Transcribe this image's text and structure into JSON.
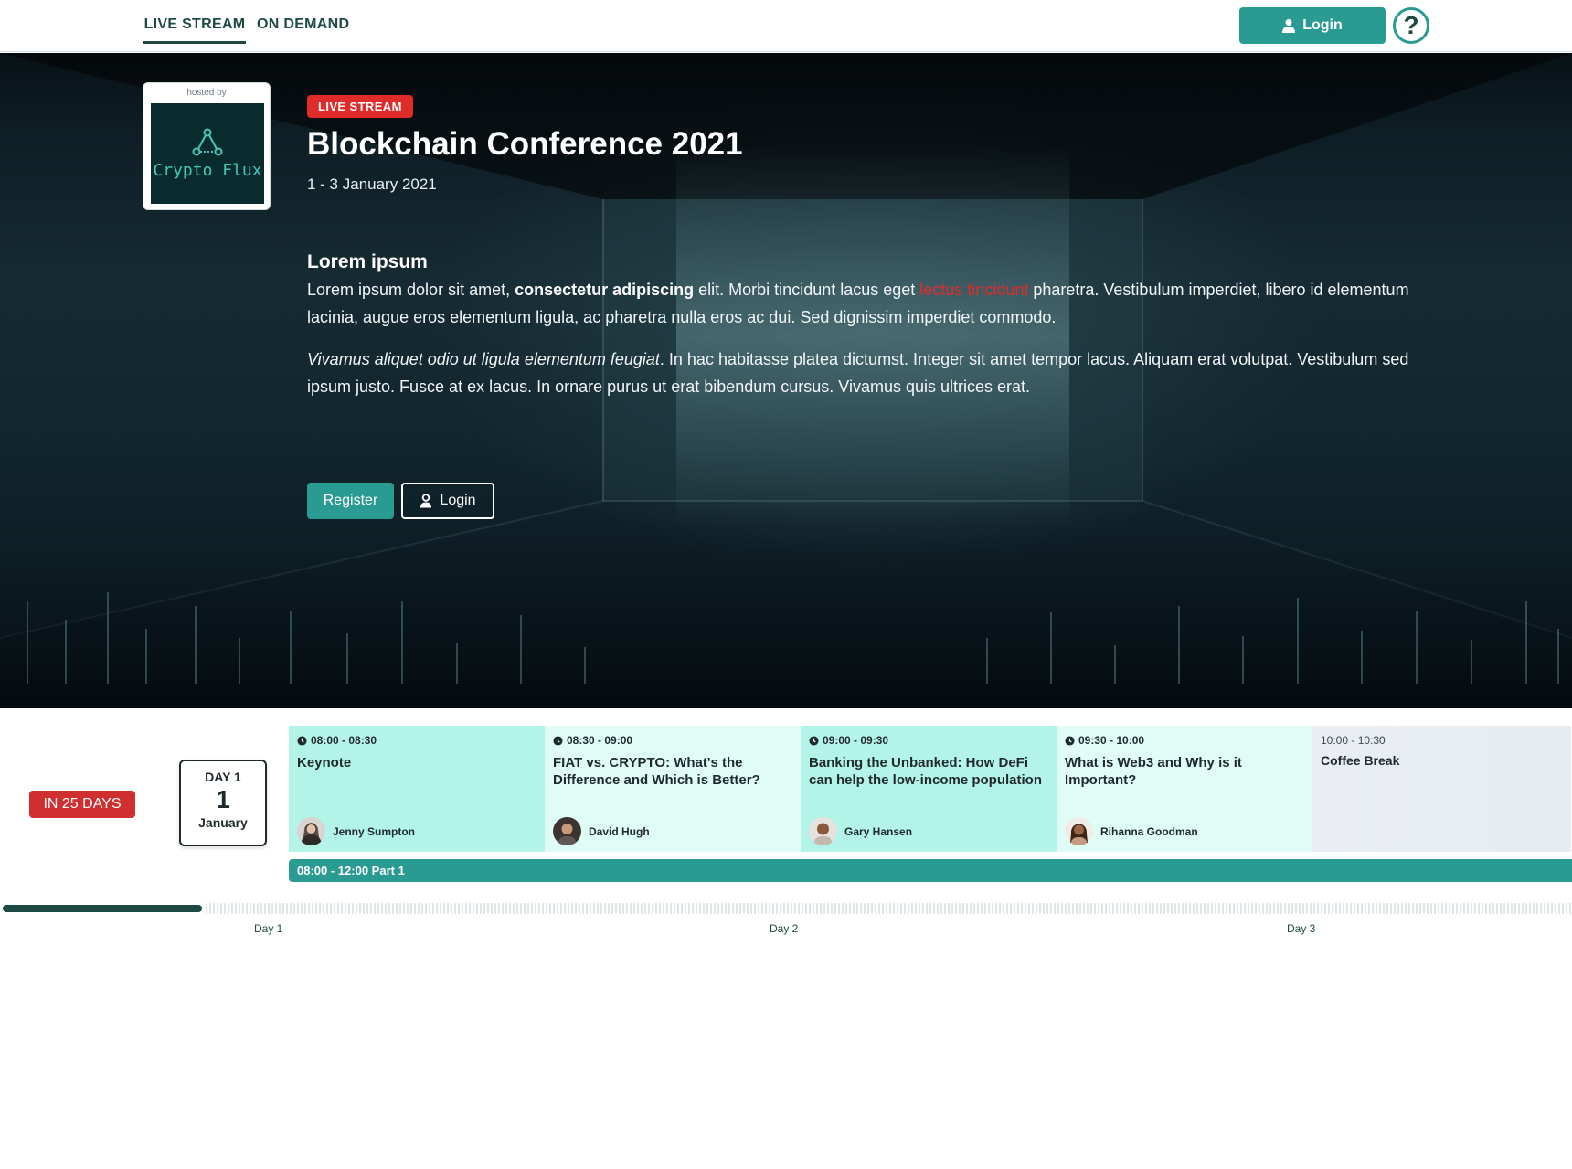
{
  "nav": {
    "tabs": [
      {
        "label": "LIVE STREAM",
        "active": true
      },
      {
        "label": "ON DEMAND",
        "active": false
      }
    ],
    "login_label": "Login",
    "help_symbol": "?",
    "accent": "#2a9b93"
  },
  "hero": {
    "host_label": "hosted by",
    "host_name": "Crypto Flux",
    "badge": "LIVE STREAM",
    "title": "Blockchain Conference 2021",
    "dates": "1 - 3 January 2021",
    "description": {
      "heading": "Lorem ipsum",
      "p1_a": "Lorem ipsum dolor sit amet, ",
      "p1_bold": "consectetur adipiscing",
      "p1_b": " elit. Morbi tincidunt lacus eget ",
      "p1_red": "lectus tincidunt",
      "p1_c": " pharetra. Vestibulum imperdiet, libero id elementum lacinia, augue eros elementum ligula, ac pharetra nulla eros ac dui. Sed dignissim imperdiet commodo.",
      "p2_italic": "Vivamus aliquet odio ut ligula elementum feugiat",
      "p2_rest": ". In hac habitasse platea dictumst. Integer sit amet tempor lacus. Aliquam erat volutpat. Vestibulum sed ipsum justo. Fusce at ex lacus. In ornare purus ut erat bibendum cursus. Vivamus quis ultrices erat."
    },
    "register_label": "Register",
    "login_label": "Login"
  },
  "schedule": {
    "countdown": "IN 25 DAYS",
    "day": {
      "label": "DAY 1",
      "number": "1",
      "month": "January"
    },
    "sessions": [
      {
        "time": "08:00 - 08:30",
        "title": "Keynote",
        "speaker": "Jenny Sumpton"
      },
      {
        "time": "08:30 - 09:00",
        "title": "FIAT vs. CRYPTO: What's the Difference and Which is Better?",
        "speaker": "David Hugh"
      },
      {
        "time": "09:00 - 09:30",
        "title": "Banking the Unbanked: How DeFi can help the low-income population",
        "speaker": "Gary Hansen"
      },
      {
        "time": "09:30 - 10:00",
        "title": "What is Web3 and Why is it Important?",
        "speaker": "Rihanna Goodman"
      },
      {
        "time": "10:00 - 10:30",
        "title": "Coffee Break"
      }
    ],
    "part": "08:00 - 12:00 Part 1",
    "timeline_labels": [
      "Day 1",
      "Day 2",
      "Day 3"
    ]
  }
}
